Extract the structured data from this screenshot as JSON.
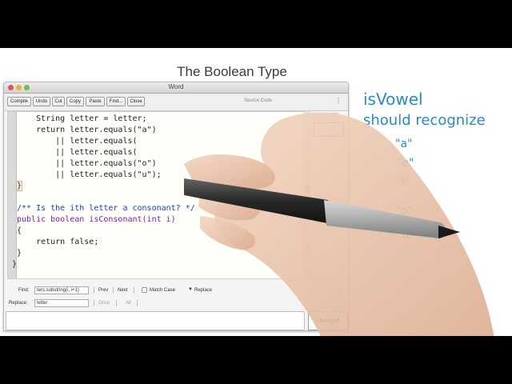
{
  "lesson_title": "The Boolean Type",
  "window": {
    "title": "Word",
    "toolbar": {
      "buttons": [
        "Compile",
        "Undo",
        "Cut",
        "Copy",
        "Paste",
        "Find...",
        "Close"
      ],
      "source_label": "Source Code"
    }
  },
  "code_lines": [
    "    String letter = letter;",
    "    return letter.equals(\"a\")",
    "        || letter.equals(",
    "        || letter.equals(",
    "        || letter.equals(\"o\")",
    "        || letter.equals(\"u\");",
    "}",
    "",
    "/** Is the ith letter a consonant? */",
    "public boolean isConsonant(int i)",
    "{",
    "    return false;",
    "}",
    "}"
  ],
  "find_bar": {
    "find_label": "Find:",
    "find_value": "ters.substring(i, i+1)",
    "prev": "Prev",
    "next": "Next",
    "match_case": "Match Case",
    "replace_toggle": "Replace",
    "replace_label": "Replace:",
    "replace_value": "letter",
    "once": "Once",
    "all": "All"
  },
  "status": {
    "changed": "changed"
  },
  "notes": {
    "title": "isVowel",
    "subtitle": "should recognize",
    "vowels": [
      "\"a\"",
      "\"e\"",
      "\"i\"",
      "\"o\"",
      "\"u\""
    ]
  },
  "colors": {
    "note_blue": "#2a8bc3",
    "keyword_purple": "#7a1fa2",
    "comment_blue": "#1a3fbf"
  }
}
